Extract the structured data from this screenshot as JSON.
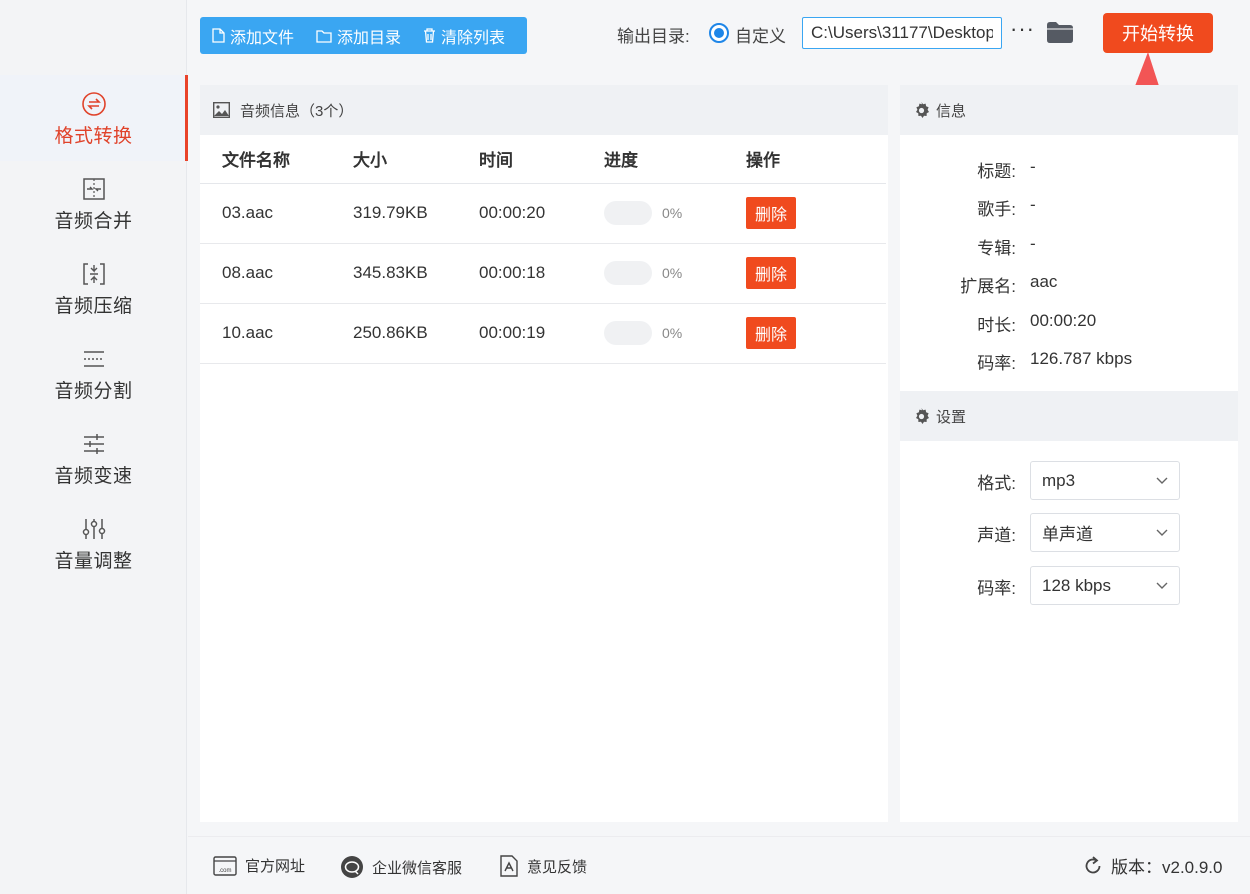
{
  "sidebar": {
    "items": [
      {
        "label": "格式转换",
        "icon": "format-convert-icon",
        "active": true
      },
      {
        "label": "音频合并",
        "icon": "merge-icon",
        "active": false
      },
      {
        "label": "音频压缩",
        "icon": "compress-icon",
        "active": false
      },
      {
        "label": "音频分割",
        "icon": "split-icon",
        "active": false
      },
      {
        "label": "音频变速",
        "icon": "speed-icon",
        "active": false
      },
      {
        "label": "音量调整",
        "icon": "volume-adjust-icon",
        "active": false
      }
    ]
  },
  "toolbar": {
    "add_file": "添加文件",
    "add_dir": "添加目录",
    "clear_list": "清除列表",
    "output_label": "输出目录:",
    "custom_label": "自定义",
    "output_path": "C:\\Users\\31177\\Desktop",
    "more": "···",
    "start_label": "开始转换"
  },
  "file_panel": {
    "title": "音频信息（3个）",
    "columns": [
      "文件名称",
      "大小",
      "时间",
      "进度",
      "操作"
    ],
    "rows": [
      {
        "name": "03.aac",
        "size": "319.79KB",
        "time": "00:00:20",
        "progress": 0,
        "progress_text": "0%",
        "action": "删除"
      },
      {
        "name": "08.aac",
        "size": "345.83KB",
        "time": "00:00:18",
        "progress": 0,
        "progress_text": "0%",
        "action": "删除"
      },
      {
        "name": "10.aac",
        "size": "250.86KB",
        "time": "00:00:19",
        "progress": 0,
        "progress_text": "0%",
        "action": "删除"
      }
    ]
  },
  "info": {
    "title": "信息",
    "rows": [
      {
        "k": "标题:",
        "v": "-"
      },
      {
        "k": "歌手:",
        "v": "-"
      },
      {
        "k": "专辑:",
        "v": "-"
      },
      {
        "k": "扩展名:",
        "v": "aac"
      },
      {
        "k": "时长:",
        "v": "00:00:20"
      },
      {
        "k": "码率:",
        "v": "126.787 kbps"
      }
    ]
  },
  "settings": {
    "title": "设置",
    "rows": [
      {
        "k": "格式:",
        "v": "mp3"
      },
      {
        "k": "声道:",
        "v": "单声道"
      },
      {
        "k": "码率:",
        "v": "128 kbps"
      }
    ]
  },
  "footer": {
    "website": "官方网址",
    "wechat": "企业微信客服",
    "feedback": "意见反馈",
    "version": "版本：v2.0.9.0"
  },
  "colors": {
    "accent_blue": "#3aa6f2",
    "accent_red": "#f04a1e",
    "active_red": "#e0422a"
  }
}
